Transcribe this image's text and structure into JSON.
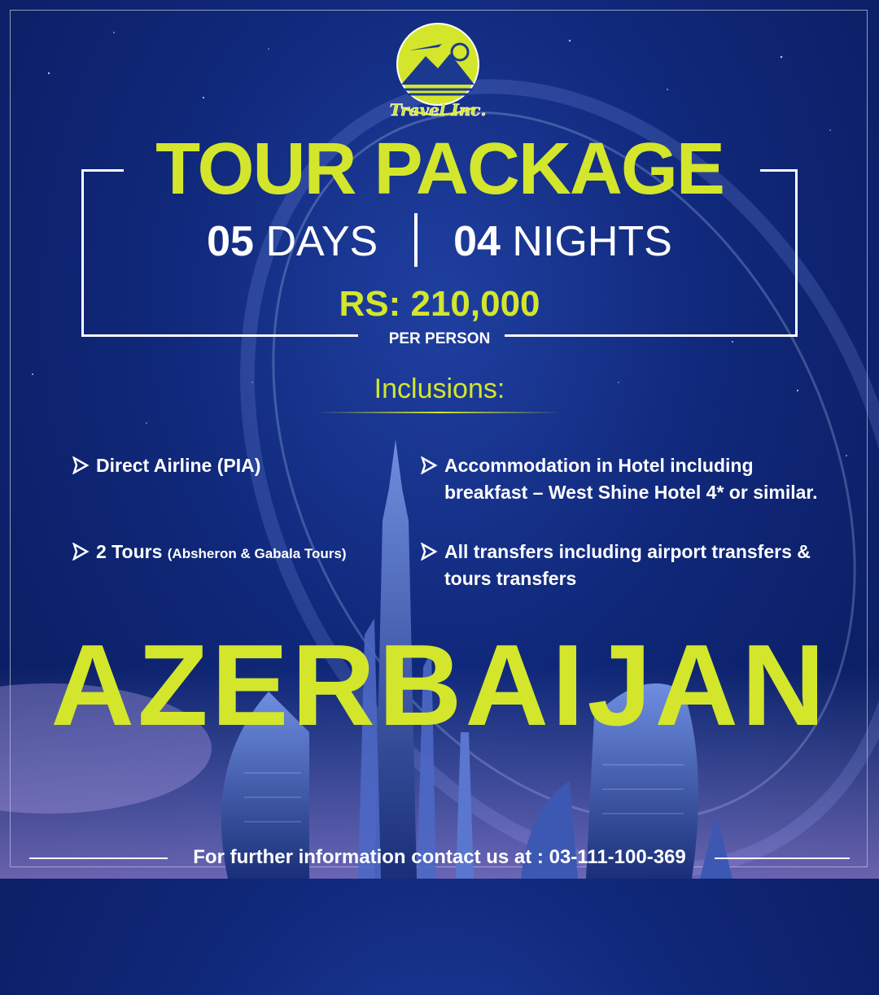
{
  "brand": {
    "logo_text": "Travel Inc."
  },
  "header": {
    "title": "TOUR PACKAGE",
    "days_number": "05",
    "days_label": "DAYS",
    "nights_number": "04",
    "nights_label": "NIGHTS",
    "price": "RS: 210,000",
    "price_note": "PER PERSON"
  },
  "inclusions": {
    "title": "Inclusions:",
    "items": [
      {
        "text": "Direct Airline (PIA)",
        "small": ""
      },
      {
        "text": "Accommodation in Hotel including",
        "line2": "breakfast – West Shine Hotel 4* or similar.",
        "small": ""
      },
      {
        "text": "2 Tours",
        "small": "(Absheron & Gabala Tours)"
      },
      {
        "text": "All transfers including airport transfers &",
        "line2": "tours transfers",
        "small": ""
      }
    ]
  },
  "destination": "AZERBAIJAN",
  "footer": {
    "contact": "For further information contact us at : 03-111-100-369"
  },
  "colors": {
    "accent": "#d3e62c",
    "background": "#10287a",
    "text": "#ffffff"
  }
}
